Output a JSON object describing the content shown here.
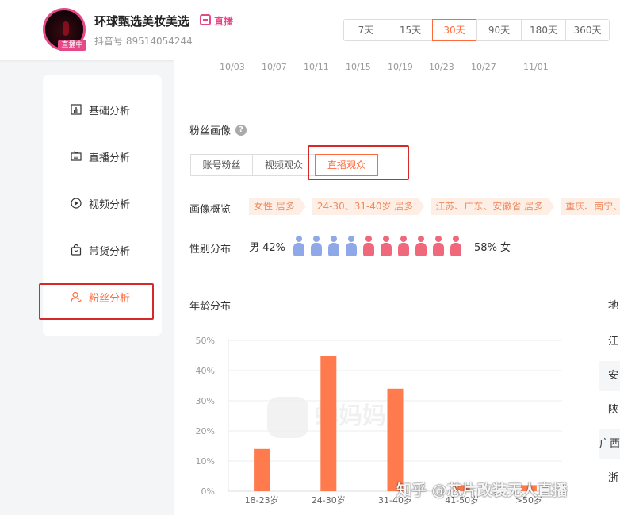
{
  "header": {
    "live_badge": "直播中",
    "anchor_name": "环球甄选美妆美选",
    "tag": "直播",
    "douyin_id": "抖音号 89514054244",
    "range_tabs": [
      "7天",
      "15天",
      "30天",
      "90天",
      "180天",
      "360天"
    ],
    "active_range": "30天"
  },
  "date_axis": [
    "10/03",
    "10/07",
    "10/11",
    "10/15",
    "10/19",
    "10/23",
    "10/27",
    "11/01"
  ],
  "sidebar": {
    "items": [
      {
        "label": "基础分析",
        "icon": "bar-chart-icon"
      },
      {
        "label": "直播分析",
        "icon": "live-icon"
      },
      {
        "label": "视频分析",
        "icon": "play-circle-icon"
      },
      {
        "label": "带货分析",
        "icon": "shopping-bag-icon"
      },
      {
        "label": "粉丝分析",
        "icon": "user-icon"
      }
    ],
    "active": "粉丝分析"
  },
  "fans": {
    "title": "粉丝画像",
    "tabs": [
      "账号粉丝",
      "视频观众",
      "直播观众"
    ],
    "active_tab": "直播观众",
    "overview_label": "画像概览",
    "overview_tags": [
      "女性 居多",
      "24-30、31-40岁 居多",
      "江苏、广东、安徽省 居多",
      "重庆、南宁、"
    ],
    "gender_label": "性别分布",
    "male_text": "男 42%",
    "female_text": "58% 女",
    "male_count": 4,
    "female_count": 6,
    "colors": {
      "male": "#8fa8e8",
      "female": "#f0687c",
      "accent": "#ff6b3d"
    }
  },
  "age": {
    "title": "年龄分布"
  },
  "region_partial": {
    "header": "地",
    "cells": [
      "江",
      "安",
      "陕",
      "广西",
      "浙"
    ]
  },
  "watermark": "蝉妈妈",
  "overlay_caption": "知乎 @芯片改装无人直播",
  "chart_data": {
    "type": "bar",
    "title": "年龄分布",
    "categories": [
      "18-23岁",
      "24-30岁",
      "31-40岁",
      "41-50岁",
      ">50岁"
    ],
    "values": [
      14,
      45,
      34,
      2,
      2
    ],
    "yticks": [
      "0%",
      "10%",
      "20%",
      "30%",
      "40%",
      "50%"
    ],
    "ylim": [
      0,
      50
    ],
    "grid": true,
    "color": "#ff7a4d"
  }
}
